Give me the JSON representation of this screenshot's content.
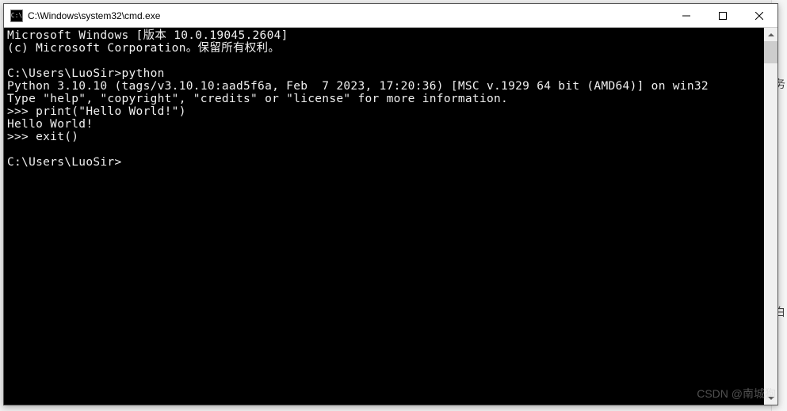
{
  "window": {
    "title": "C:\\Windows\\system32\\cmd.exe",
    "icon_label": "C:\\"
  },
  "terminal": {
    "lines": [
      "Microsoft Windows [版本 10.0.19045.2604]",
      "(c) Microsoft Corporation。保留所有权利。",
      "",
      "C:\\Users\\LuoSir>python",
      "Python 3.10.10 (tags/v3.10.10:aad5f6a, Feb  7 2023, 17:20:36) [MSC v.1929 64 bit (AMD64)] on win32",
      "Type \"help\", \"copyright\", \"credits\" or \"license\" for more information.",
      ">>> print(\"Hello World!\")",
      "Hello World!",
      ">>> exit()",
      "",
      "C:\\Users\\LuoSir>"
    ]
  },
  "watermark": "CSDN @南城狗",
  "bg_hints": {
    "char1": "务",
    "char2": "白"
  }
}
